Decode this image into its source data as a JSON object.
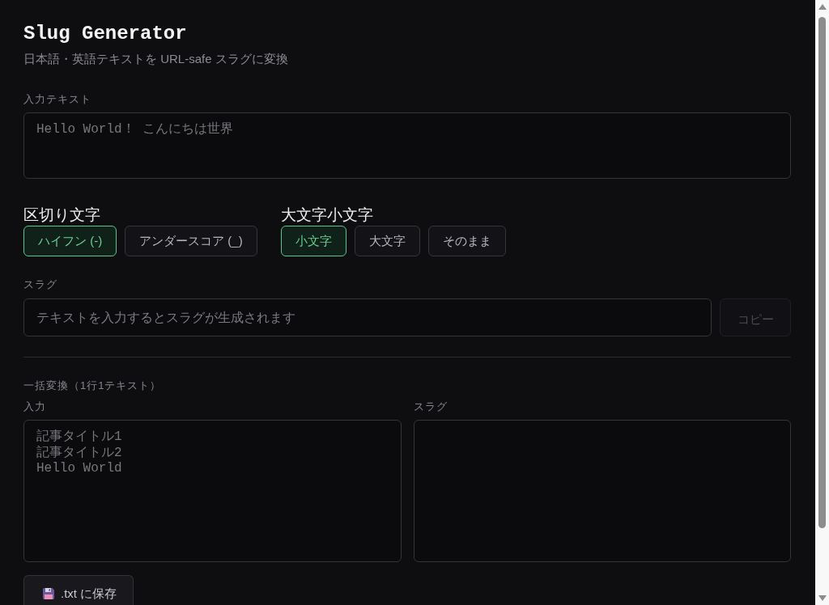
{
  "header": {
    "title": "Slug Generator",
    "subtitle": "日本語・英語テキストを URL-safe スラグに変換"
  },
  "input": {
    "label": "入力テキスト",
    "placeholder": "Hello World！ こんにちは世界"
  },
  "option_groups": [
    {
      "title": "区切り文字",
      "options": [
        {
          "label": "ハイフン (-)",
          "selected": true
        },
        {
          "label": "アンダースコア (_)",
          "selected": false
        }
      ]
    },
    {
      "title": "大文字小文字",
      "options": [
        {
          "label": "小文字",
          "selected": true
        },
        {
          "label": "大文字",
          "selected": false
        },
        {
          "label": "そのまま",
          "selected": false
        }
      ]
    }
  ],
  "slug": {
    "label": "スラグ",
    "placeholder": "テキストを入力するとスラグが生成されます",
    "copy_button": {
      "label": "コピー",
      "disabled": true
    }
  },
  "bulk": {
    "title": "一括変換（1行1テキスト）",
    "input": {
      "label": "入力",
      "placeholder": "記事タイトル1\n記事タイトル2\nHello World"
    },
    "output": {
      "label": "スラグ"
    }
  },
  "save_button": {
    "label": ".txt に保存"
  }
}
